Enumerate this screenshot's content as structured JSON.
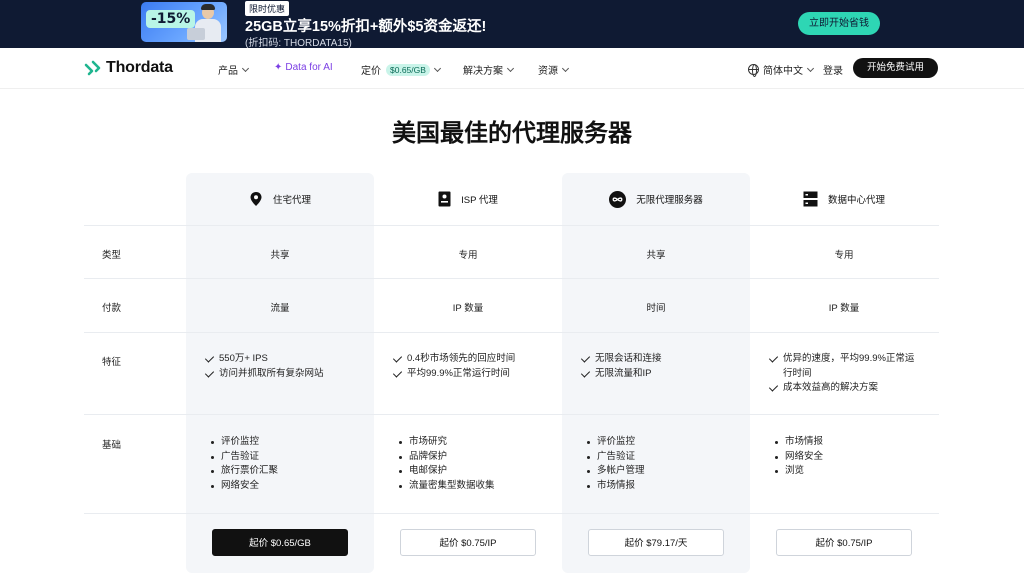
{
  "promo": {
    "discount_badge": "-15%",
    "tag": "限时优惠",
    "title": "25GB立享15%折扣+额外$5资金返还!",
    "subtitle": "(折扣码: THORDATA15)",
    "cta": "立即开始省钱"
  },
  "nav": {
    "logo": "Thordata",
    "items": [
      {
        "label": "产品",
        "dropdown": true
      },
      {
        "label": "Data for AI"
      },
      {
        "label": "定价",
        "tag": "$0.65/GB",
        "dropdown": true
      },
      {
        "label": "解决方案",
        "dropdown": true
      },
      {
        "label": "资源",
        "dropdown": true
      }
    ],
    "language": "简体中文",
    "login": "登录",
    "trial": "开始免费试用"
  },
  "main": {
    "title": "美国最佳的代理服务器",
    "row_labels": {
      "type": "类型",
      "payment": "付款",
      "features": "特征",
      "basics": "基础"
    },
    "columns": [
      {
        "icon": "location-pin-icon",
        "name": "住宅代理",
        "type": "共享",
        "payment": "流量",
        "features": [
          "550万+ IPS",
          "访问并抓取所有复杂网站"
        ],
        "basics": [
          "评价监控",
          "广告验证",
          "旅行票价汇聚",
          "网络安全"
        ],
        "price": "起价 $0.65/GB",
        "highlight": true
      },
      {
        "icon": "id-card-icon",
        "name": "ISP 代理",
        "type": "专用",
        "payment": "IP 数量",
        "features": [
          "0.4秒市场领先的回应时间",
          "平均99.9%正常运行时间"
        ],
        "basics": [
          "市场研究",
          "品牌保护",
          "电邮保护",
          "流量密集型数据收集"
        ],
        "price": "起价 $0.75/IP",
        "highlight": false
      },
      {
        "icon": "infinity-icon",
        "name": "无限代理服务器",
        "type": "共享",
        "payment": "时间",
        "features": [
          "无限会话和连接",
          "无限流量和IP"
        ],
        "basics": [
          "评价监控",
          "广告验证",
          "多帐户管理",
          "市场情报"
        ],
        "price": "起价 $79.17/天",
        "highlight": false
      },
      {
        "icon": "server-icon",
        "name": "数据中心代理",
        "type": "专用",
        "payment": "IP 数量",
        "features": [
          "优异的速度，平均99.9%正常运",
          "行时间",
          "成本效益高的解决方案"
        ],
        "basics": [
          "市场情报",
          "网络安全",
          "浏览"
        ],
        "price": "起价 $0.75/IP",
        "highlight": false
      }
    ]
  }
}
